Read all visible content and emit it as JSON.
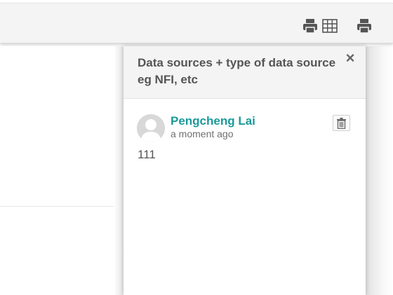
{
  "toolbar": {
    "icons": [
      "print-icon",
      "table-icon",
      "print-icon"
    ]
  },
  "comment_panel": {
    "title": "Data sources + type of data source eg NFI, etc",
    "close_label": "×",
    "comment": {
      "author": "Pengcheng Lai",
      "timestamp": "a moment ago",
      "body": "111",
      "delete_icon": "trash-icon"
    }
  },
  "colors": {
    "author_link": "#1a9a9a",
    "header_bg": "#f4f4f4",
    "text": "#555555"
  }
}
